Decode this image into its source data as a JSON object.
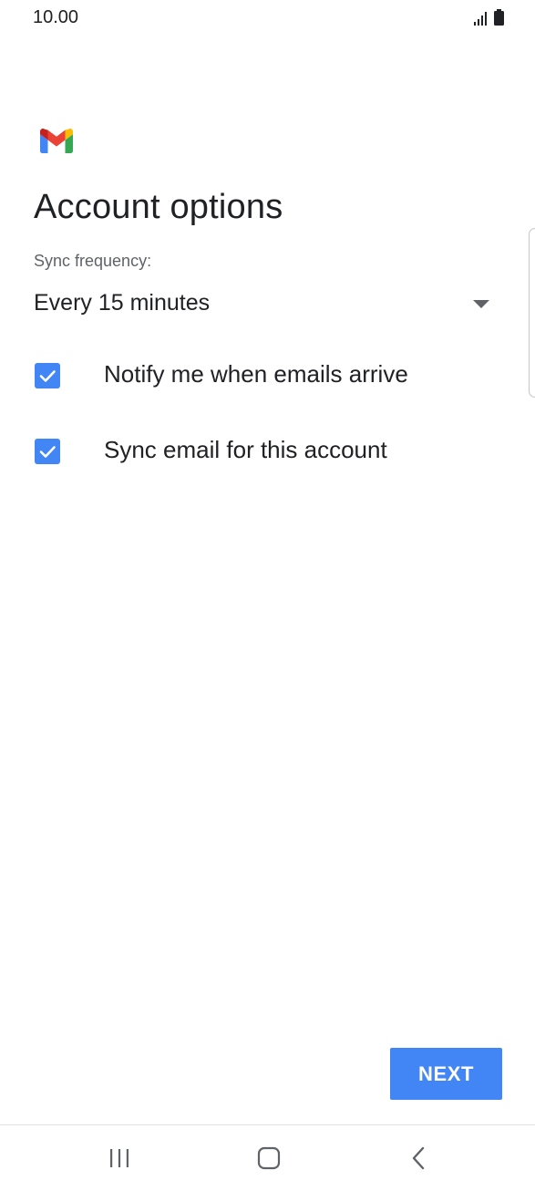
{
  "status_bar": {
    "time": "10.00",
    "icons": [
      "signal-icon",
      "battery-icon"
    ]
  },
  "app": {
    "logo": "gmail-logo",
    "brand_colors": {
      "red": "#ea4335",
      "blue": "#4285f4",
      "green": "#34a853",
      "yellow": "#fbbc04"
    }
  },
  "page": {
    "title": "Account options",
    "sync_frequency_label": "Sync frequency:",
    "sync_frequency_value": "Every 15 minutes",
    "options": [
      {
        "label": "Notify me when emails arrive",
        "checked": true
      },
      {
        "label": "Sync email for this account",
        "checked": true
      }
    ],
    "next_label": "NEXT"
  },
  "nav_bar": {
    "buttons": [
      "recents-icon",
      "home-icon",
      "back-icon"
    ]
  },
  "colors": {
    "accent": "#4285f4",
    "text_primary": "#202124",
    "text_secondary": "#5f6368"
  }
}
